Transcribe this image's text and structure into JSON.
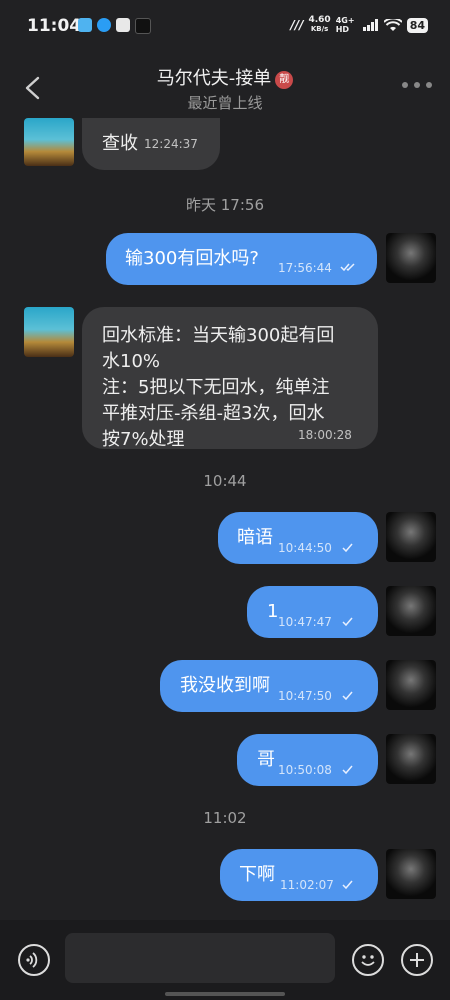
{
  "status_bar": {
    "time": "11:04",
    "speed_value": "4.60",
    "speed_unit": "KB/s",
    "network": "4G+ HD",
    "battery": "84"
  },
  "header": {
    "title": "马尔代夫-接单",
    "badge": "靓",
    "subtitle": "最近曾上线"
  },
  "messages": [
    {
      "text": "查收",
      "time": "12:24:37",
      "side": "in"
    },
    {
      "separator": "昨天 17:56"
    },
    {
      "text": "输300有回水吗?",
      "time": "17:56:44",
      "side": "out",
      "read": true
    },
    {
      "lines": [
        "回水标准：当天输300起有回",
        "水10%",
        "注：5把以下无回水，纯单注",
        "平推对压-杀组-超3次，回水",
        "按7%处理"
      ],
      "time": "18:00:28",
      "side": "in"
    },
    {
      "separator": "10:44"
    },
    {
      "text": "暗语",
      "time": "10:44:50",
      "side": "out"
    },
    {
      "text": "1",
      "time": "10:47:47",
      "side": "out"
    },
    {
      "text": "我没收到啊",
      "time": "10:47:50",
      "side": "out"
    },
    {
      "text": "哥",
      "time": "10:50:08",
      "side": "out"
    },
    {
      "separator": "11:02"
    },
    {
      "text": "下啊",
      "time": "11:02:07",
      "side": "out"
    }
  ],
  "icons": {
    "back": "chevron-left-icon",
    "more": "more-icon",
    "voice": "voice-icon",
    "emoji": "emoji-icon",
    "add": "plus-icon"
  }
}
